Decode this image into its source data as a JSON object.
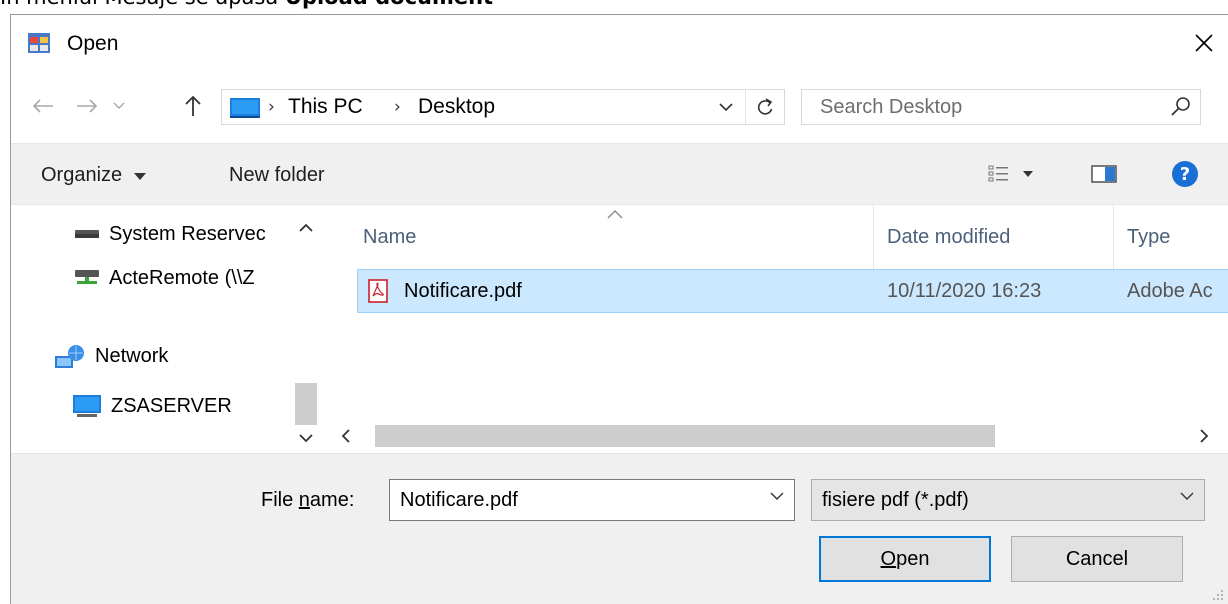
{
  "caption": {
    "prefix": "In meniul Mesaje se apasa ",
    "bold": "Upload document"
  },
  "window": {
    "title": "Open"
  },
  "address_bar": {
    "crumbs": [
      "This PC",
      "Desktop"
    ],
    "search_placeholder": "Search Desktop"
  },
  "toolbar": {
    "organize": "Organize",
    "new_folder": "New folder"
  },
  "nav_pane": {
    "items": [
      {
        "label": "System Reservec",
        "icon": "drive-icon"
      },
      {
        "label": "ActeRemote (\\\\Z",
        "icon": "network-drive-icon"
      },
      {
        "label": "Network",
        "icon": "network-icon"
      },
      {
        "label": "ZSASERVER",
        "icon": "computer-icon"
      }
    ]
  },
  "file_list": {
    "columns": [
      "Name",
      "Date modified",
      "Type"
    ],
    "rows": [
      {
        "name": "Notificare.pdf",
        "date": "10/11/2020 16:23",
        "type": "Adobe Ac",
        "icon": "pdf-icon",
        "selected": true
      }
    ]
  },
  "footer": {
    "file_name_label_pre": "File ",
    "file_name_label_u": "n",
    "file_name_label_post": "ame:",
    "file_name_value": "Notificare.pdf",
    "file_type_value": "fisiere pdf (*.pdf)",
    "open_u": "O",
    "open_rest": "pen",
    "cancel": "Cancel"
  },
  "colors": {
    "selection": "#cce8ff",
    "selection_border": "#99d1ff",
    "accent": "#0078d7",
    "help": "#1a6fd6"
  }
}
